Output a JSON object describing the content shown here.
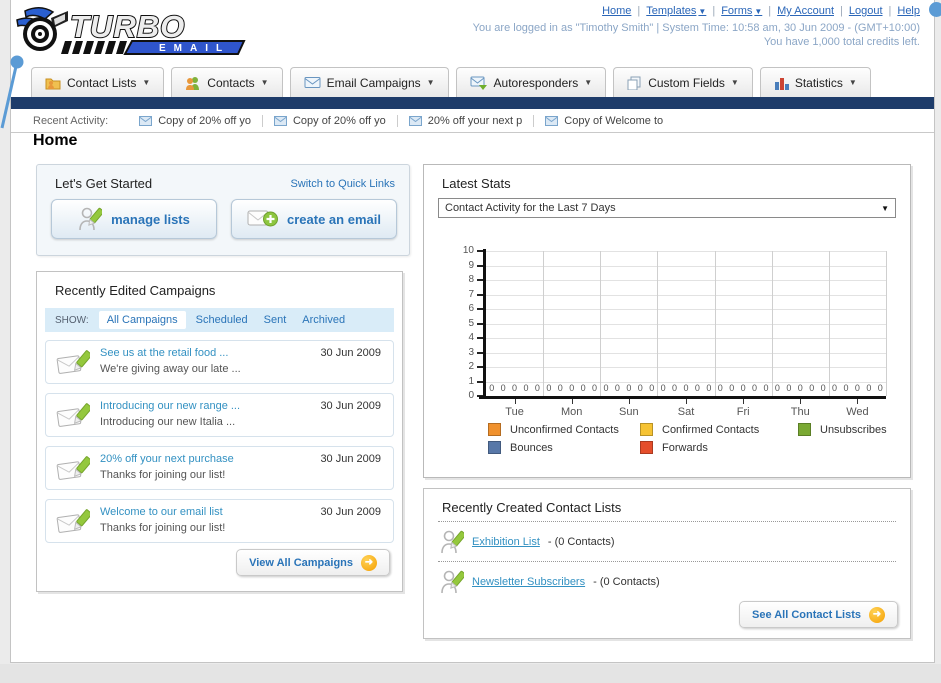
{
  "header": {
    "nav_links": [
      {
        "label": "Home"
      },
      {
        "label": "Templates"
      },
      {
        "label": "Forms"
      },
      {
        "label": "My Account"
      },
      {
        "label": "Logout"
      },
      {
        "label": "Help"
      }
    ],
    "login_info": "You are logged in as \"Timothy Smith\" | System Time: 10:58 am, 30 Jun 2009 - (GMT+10:00)",
    "credits_info": "You have 1,000 total credits left.",
    "logo_title": "TURBO",
    "logo_subtitle": "EMAIL"
  },
  "nav_tabs": [
    {
      "label": "Contact Lists"
    },
    {
      "label": "Contacts"
    },
    {
      "label": "Email Campaigns"
    },
    {
      "label": "Autoresponders"
    },
    {
      "label": "Custom Fields"
    },
    {
      "label": "Statistics"
    }
  ],
  "recent_activity": {
    "label": "Recent Activity:",
    "items": [
      "Copy of 20% off yo",
      "Copy of 20% off yo",
      "20% off your next p",
      "Copy of Welcome to"
    ]
  },
  "page_title": "Home",
  "get_started": {
    "title": "Let's Get Started",
    "switch_link": "Switch to Quick Links",
    "manage_lists_label": "manage lists",
    "create_email_label": "create an email"
  },
  "campaigns": {
    "title": "Recently Edited Campaigns",
    "show_label": "SHOW:",
    "filters": [
      "All Campaigns",
      "Scheduled",
      "Sent",
      "Archived"
    ],
    "active_filter": "All Campaigns",
    "items": [
      {
        "title": "See us at the retail food ...",
        "subtitle": "We're giving away our late ...",
        "date": "30 Jun 2009"
      },
      {
        "title": "Introducing our new range ...",
        "subtitle": "Introducing our new Italia ...",
        "date": "30 Jun 2009"
      },
      {
        "title": "20% off your next purchase",
        "subtitle": "Thanks for joining our list!",
        "date": "30 Jun 2009"
      },
      {
        "title": "Welcome to our email list",
        "subtitle": "Thanks for joining our list!",
        "date": "30 Jun 2009"
      }
    ],
    "view_all_label": "View All Campaigns"
  },
  "stats": {
    "title": "Latest Stats",
    "selected_option": "Contact Activity for the Last 7 Days"
  },
  "chart_data": {
    "type": "bar",
    "title": "Contact Activity for the Last 7 Days",
    "categories": [
      "Tue",
      "Mon",
      "Sun",
      "Sat",
      "Fri",
      "Thu",
      "Wed"
    ],
    "series": [
      {
        "name": "Unconfirmed Contacts",
        "color": "#f0912d",
        "values": [
          0,
          0,
          0,
          0,
          0,
          0,
          0
        ]
      },
      {
        "name": "Confirmed Contacts",
        "color": "#f6c333",
        "values": [
          0,
          0,
          0,
          0,
          0,
          0,
          0
        ]
      },
      {
        "name": "Unsubscribes",
        "color": "#7aa933",
        "values": [
          0,
          0,
          0,
          0,
          0,
          0,
          0
        ]
      },
      {
        "name": "Bounces",
        "color": "#5878a8",
        "values": [
          0,
          0,
          0,
          0,
          0,
          0,
          0
        ]
      },
      {
        "name": "Forwards",
        "color": "#e54e2b",
        "values": [
          0,
          0,
          0,
          0,
          0,
          0,
          0
        ]
      }
    ],
    "ylim": [
      0,
      10
    ],
    "yticks": [
      0,
      1,
      2,
      3,
      4,
      5,
      6,
      7,
      8,
      9,
      10
    ],
    "grid": true,
    "legend_position": "bottom"
  },
  "contact_lists": {
    "title": "Recently Created Contact Lists",
    "items": [
      {
        "name": "Exhibition List",
        "detail": "- (0 Contacts)"
      },
      {
        "name": "Newsletter Subscribers",
        "detail": "- (0 Contacts)"
      }
    ],
    "see_all_label": "See All Contact Lists"
  }
}
